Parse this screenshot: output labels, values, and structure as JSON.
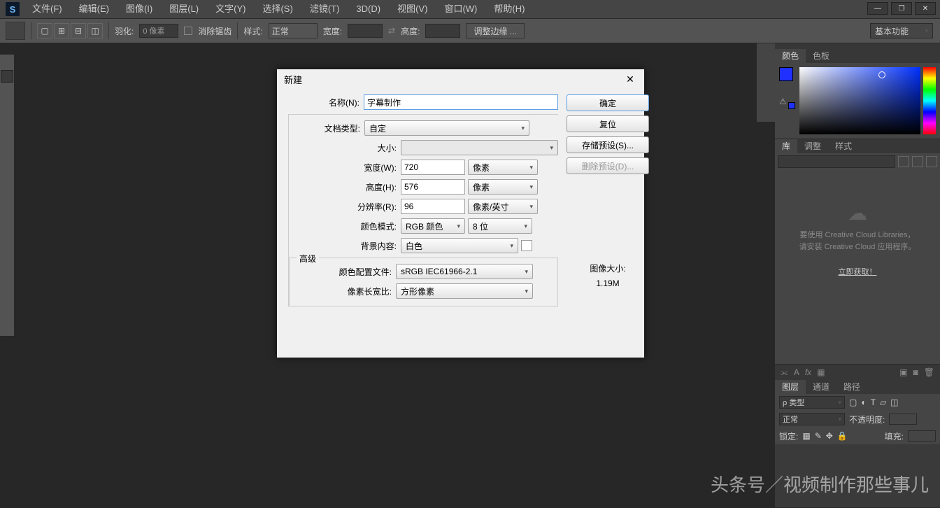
{
  "menu": {
    "items": [
      "文件(F)",
      "编辑(E)",
      "图像(I)",
      "图层(L)",
      "文字(Y)",
      "选择(S)",
      "滤镜(T)",
      "3D(D)",
      "视图(V)",
      "窗口(W)",
      "帮助(H)"
    ]
  },
  "optbar": {
    "feather_label": "羽化:",
    "feather_val": "0 像素",
    "antialias": "消除锯齿",
    "style_label": "样式:",
    "style_val": "正常",
    "width_label": "宽度:",
    "height_label": "高度:",
    "refine": "调整边缘 ...",
    "workspace": "基本功能"
  },
  "panels": {
    "color_tab": "颜色",
    "swatches_tab": "色板",
    "lib_tab": "库",
    "adjust_tab": "调整",
    "styles_tab": "样式",
    "lib_msg1": "要使用 Creative Cloud Libraries，",
    "lib_msg2": "请安装 Creative Cloud 应用程序。",
    "lib_link": "立即获取！",
    "layers_tab": "图层",
    "channels_tab": "通道",
    "paths_tab": "路径",
    "kind": "ρ 类型",
    "blend": "正常",
    "opacity_label": "不透明度:",
    "lock_label": "锁定:",
    "fill_label": "填充:"
  },
  "dialog": {
    "title": "新建",
    "name_label": "名称(N):",
    "name_val": "字幕制作",
    "preset_label": "文档类型:",
    "preset_val": "自定",
    "size_label": "大小:",
    "width_label": "宽度(W):",
    "width_val": "720",
    "width_unit": "像素",
    "height_label": "高度(H):",
    "height_val": "576",
    "height_unit": "像素",
    "res_label": "分辨率(R):",
    "res_val": "96",
    "res_unit": "像素/英寸",
    "mode_label": "颜色模式:",
    "mode_val": "RGB 颜色",
    "depth": "8 位",
    "bg_label": "背景内容:",
    "bg_val": "白色",
    "adv_label": "高级",
    "profile_label": "颜色配置文件:",
    "profile_val": "sRGB IEC61966-2.1",
    "aspect_label": "像素长宽比:",
    "aspect_val": "方形像素",
    "ok": "确定",
    "reset": "复位",
    "save_preset": "存储预设(S)...",
    "del_preset": "删除预设(D)...",
    "imgsize_label": "图像大小:",
    "imgsize_val": "1.19M"
  },
  "watermark": "头条号／视频制作那些事儿"
}
